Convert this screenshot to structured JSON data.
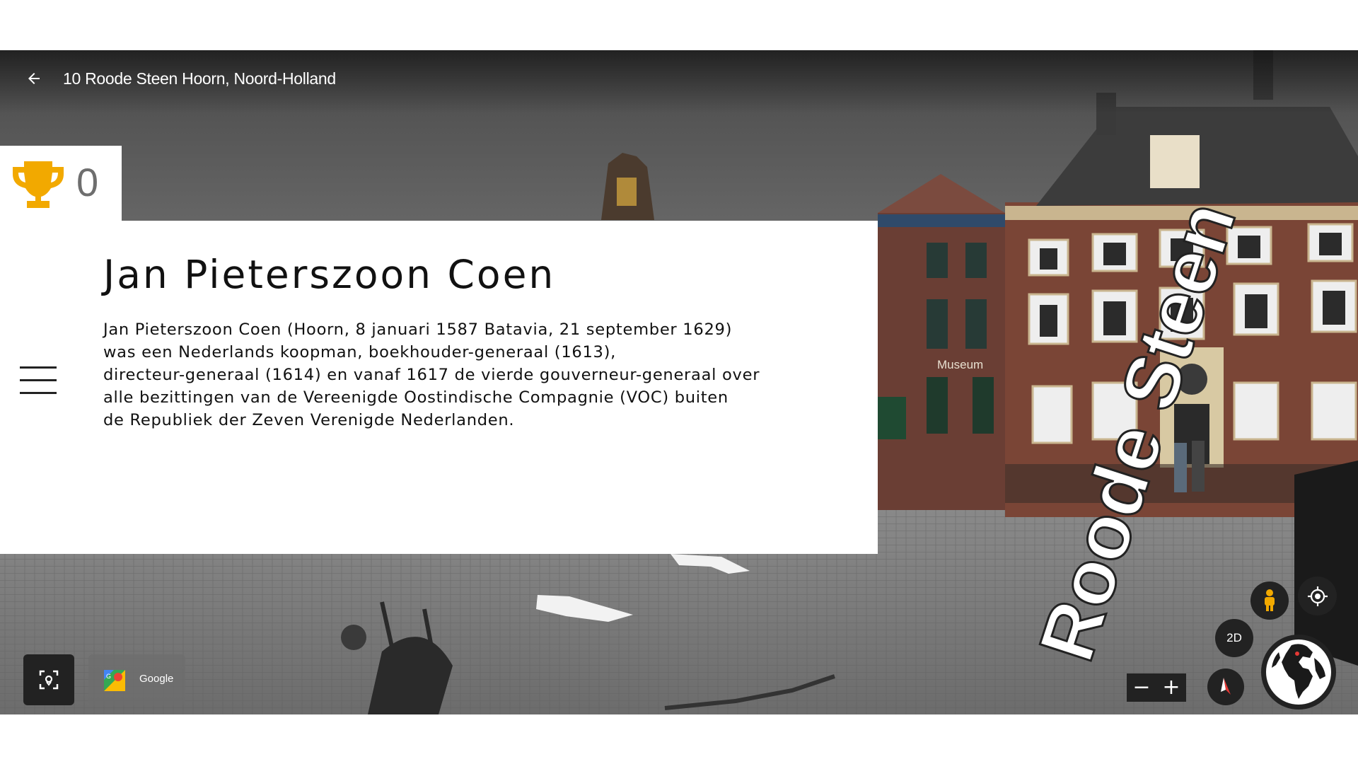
{
  "header": {
    "back_icon": "arrow-left-icon",
    "address": "10 Roode Steen Hoorn, Noord-Holland"
  },
  "score": {
    "icon": "trophy-icon",
    "value": "0",
    "icon_color": "#F2A900"
  },
  "info_panel": {
    "menu_icon": "hamburger-menu-icon",
    "title": "Jan Pieterszoon Coen",
    "description_lines": [
      "Jan Pieterszoon Coen (Hoorn, 8 januari 1587 Batavia, 21 september 1629)",
      "was een Nederlands koopman, boekhouder-generaal (1613),",
      "directeur-generaal (1614) en vanaf 1617 de vierde gouverneur-generaal over",
      "alle bezittingen van de Vereenigde Oostindische Compagnie (VOC) buiten",
      "de Republiek der Zeven Verenigde Nederlanden."
    ]
  },
  "scene": {
    "building_sign": "Museum",
    "street_label": "Roode Steen"
  },
  "controls": {
    "capture_icon": "camera-focus-icon",
    "google_maps_label": "Google",
    "google_maps_icon": "google-maps-icon",
    "pegman_icon": "pegman-icon",
    "locate_icon": "my-location-icon",
    "view_2d_label": "2D",
    "zoom_out_label": "−",
    "zoom_in_label": "+",
    "compass_icon": "compass-icon",
    "globe_icon": "globe-icon"
  }
}
